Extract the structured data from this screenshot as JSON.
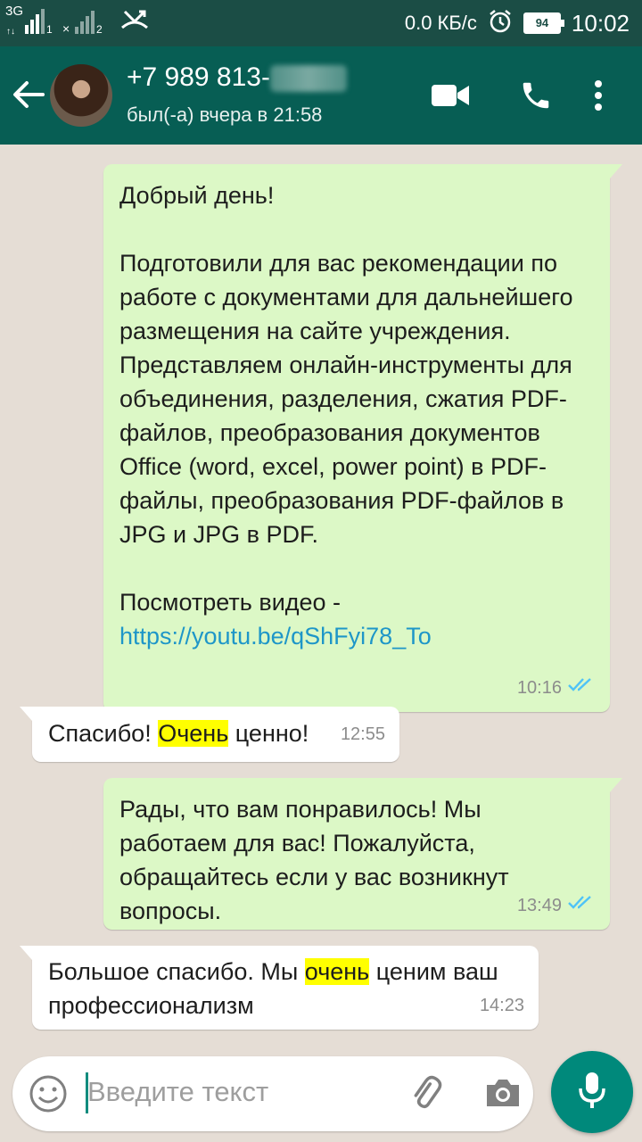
{
  "status_bar": {
    "network_1": "3G",
    "sim_1": "1",
    "sim_2": "2",
    "speed": "0.0 КБ/с",
    "battery": "94",
    "time": "10:02"
  },
  "header": {
    "contact_name": "+7 989 813-",
    "last_seen": "был(-а) вчера в 21:58",
    "icons": [
      "back-arrow-icon",
      "video-call-icon",
      "phone-icon",
      "more-vert-icon"
    ]
  },
  "messages": [
    {
      "direction": "outgoing",
      "text": "Добрый день!\n\nПодготовили для вас рекомендации по работе с документами для дальнейшего размещения на сайте учреждения. Представляем онлайн-инструменты для объединения, разделения, сжатия PDF-файлов, преобразования документов Office (word, excel, power point) в PDF-файлы, преобразования PDF-файлов в JPG и JPG в PDF.\n\n",
      "link_prefix": "Посмотреть видео - ",
      "link": "https://youtu.be/qShFyi78_To",
      "time": "10:16",
      "read": true
    },
    {
      "direction": "incoming",
      "text_before": "Спасибо! ",
      "highlight": "Очень",
      "text_after": " ценно!",
      "time": "12:55"
    },
    {
      "direction": "outgoing",
      "text": "Рады, что вам понравилось! Мы работаем для вас! Пожалуйста, обращайтесь если у вас возникнут вопросы.",
      "time": "13:49",
      "read": true
    },
    {
      "direction": "incoming",
      "text_before": "Большое спасибо. Мы ",
      "highlight": "очень",
      "text_after": " ценим ваш профессионализм",
      "time": "14:23"
    }
  ],
  "composer": {
    "placeholder": "Введите текст",
    "icons": [
      "emoji-icon",
      "attach-icon",
      "camera-icon",
      "mic-icon"
    ]
  },
  "colors": {
    "header": "#075e54",
    "status_bar": "#1b4d45",
    "outgoing_bubble": "#dcf8c6",
    "incoming_bubble": "#ffffff",
    "read_ticks": "#4fc3f7",
    "link": "#1e96c8",
    "highlight": "#ffff00",
    "mic_button": "#00897b"
  }
}
